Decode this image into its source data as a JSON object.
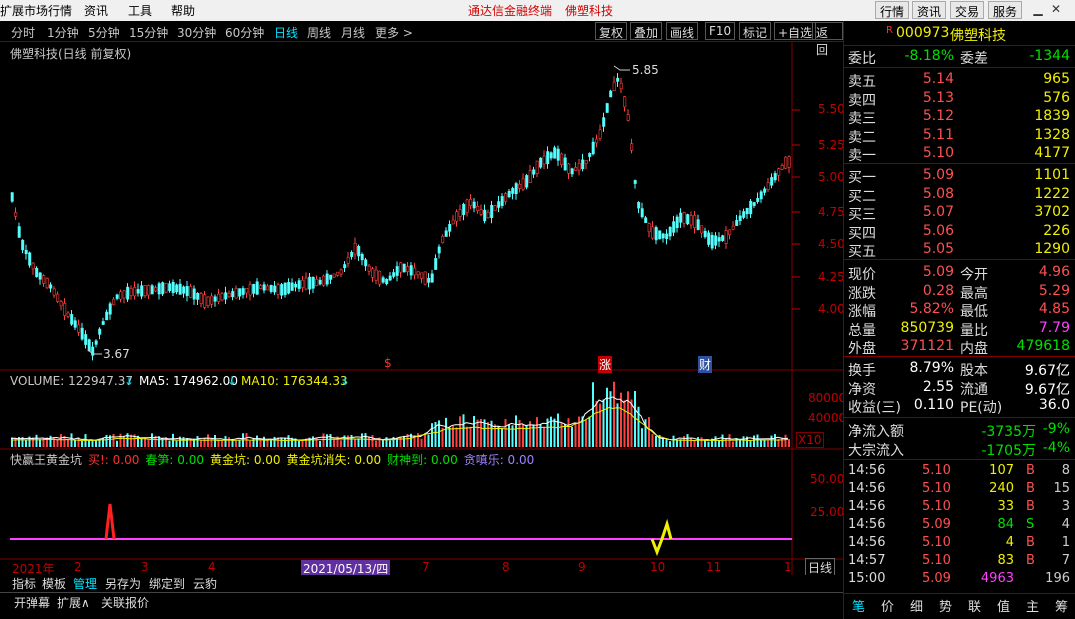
{
  "menubar": {
    "items": [
      "扩展市场行情",
      "资讯",
      "工具",
      "帮助"
    ],
    "center_title": "通达信金融终端",
    "center_stock": "佛塑科技",
    "right_buttons": [
      "行情",
      "资讯",
      "交易",
      "服务"
    ]
  },
  "toolbar": {
    "timeframes": [
      "分时",
      "1分钟",
      "5分钟",
      "15分钟",
      "30分钟",
      "60分钟",
      "日线",
      "周线",
      "月线",
      "更多 >"
    ],
    "active_timeframe": "日线",
    "buttons": [
      "复权",
      "叠加",
      "画线",
      "F10",
      "标记",
      "+自选",
      "返回"
    ]
  },
  "main_chart": {
    "title": "佛塑科技(日线 前复权)",
    "high_label": "5.85",
    "low_label": "3.67",
    "price_axis": [
      "5.50",
      "5.25",
      "5.00",
      "4.75",
      "4.50",
      "4.25",
      "4.00"
    ],
    "markers": [
      "$",
      "涨",
      "财"
    ]
  },
  "volume_panel": {
    "volume_label": "VOLUME: 122947.37",
    "ma5_label": "MA5: 174962.00",
    "ma10_label": "MA10: 176344.33",
    "axis": [
      "80000",
      "40000"
    ],
    "unit": "X10"
  },
  "indicator_panel": {
    "name": "快赢王黄金坑",
    "items": [
      {
        "label": "买!:",
        "value": "0.00",
        "color": "#ff3030"
      },
      {
        "label": "春笋:",
        "value": "0.00",
        "color": "#00e000"
      },
      {
        "label": "黄金坑:",
        "value": "0.00",
        "color": "#f0f000"
      },
      {
        "label": "黄金坑消失:",
        "value": "0.00",
        "color": "#f0f000"
      },
      {
        "label": "财神到:",
        "value": "0.00",
        "color": "#00e000"
      },
      {
        "label": "贪嗔乐:",
        "value": "0.00",
        "color": "#a080ff"
      }
    ],
    "axis": [
      "50.00",
      "25.00"
    ]
  },
  "date_axis": {
    "year_label": "2021年",
    "months": [
      "2",
      "3",
      "4",
      "7",
      "8",
      "9",
      "10",
      "11",
      "1"
    ],
    "cursor_date": "2021/05/13/四",
    "period_label": "日线"
  },
  "bottom_tabs": [
    "指标",
    "模板",
    "管理",
    "另存为",
    "绑定到",
    "云豹"
  ],
  "bottom_tabs_active": "管理",
  "bottom_tabs2": [
    "开弹幕",
    "扩展∧",
    "关联报价"
  ],
  "quote": {
    "flag": "R",
    "code": "000973",
    "name": "佛塑科技",
    "webi_label": "委比",
    "webi_value": "-8.18%",
    "weicha_label": "委差",
    "weicha_value": "-1344",
    "asks": [
      {
        "label": "卖五",
        "price": "5.14",
        "vol": "965"
      },
      {
        "label": "卖四",
        "price": "5.13",
        "vol": "576"
      },
      {
        "label": "卖三",
        "price": "5.12",
        "vol": "1839"
      },
      {
        "label": "卖二",
        "price": "5.11",
        "vol": "1328"
      },
      {
        "label": "卖一",
        "price": "5.10",
        "vol": "4177"
      }
    ],
    "bids": [
      {
        "label": "买一",
        "price": "5.09",
        "vol": "1101"
      },
      {
        "label": "买二",
        "price": "5.08",
        "vol": "1222"
      },
      {
        "label": "买三",
        "price": "5.07",
        "vol": "3702"
      },
      {
        "label": "买四",
        "price": "5.06",
        "vol": "226"
      },
      {
        "label": "买五",
        "price": "5.05",
        "vol": "1290"
      }
    ],
    "stats": [
      {
        "l1": "现价",
        "v1": "5.09",
        "c1": "red",
        "l2": "今开",
        "v2": "4.96",
        "c2": "red"
      },
      {
        "l1": "涨跌",
        "v1": "0.28",
        "c1": "red",
        "l2": "最高",
        "v2": "5.29",
        "c2": "red"
      },
      {
        "l1": "涨幅",
        "v1": "5.82%",
        "c1": "red",
        "l2": "最低",
        "v2": "4.85",
        "c2": "red"
      },
      {
        "l1": "总量",
        "v1": "850739",
        "c1": "yellow",
        "l2": "量比",
        "v2": "7.79",
        "c2": "magenta"
      },
      {
        "l1": "外盘",
        "v1": "371121",
        "c1": "red",
        "l2": "内盘",
        "v2": "479618",
        "c2": "green"
      }
    ],
    "stats2": [
      {
        "l1": "换手",
        "v1": "8.79%",
        "l2": "股本",
        "v2": "9.67亿"
      },
      {
        "l1": "净资",
        "v1": "2.55",
        "l2": "流通",
        "v2": "9.67亿"
      },
      {
        "l1": "收益(三)",
        "v1": "0.110",
        "l2": "PE(动)",
        "v2": "36.0"
      }
    ],
    "flows": [
      {
        "label": "净流入额",
        "value": "-3735万",
        "pct": "-9%"
      },
      {
        "label": "大宗流入",
        "value": "-1705万",
        "pct": "-4%"
      }
    ],
    "ticks": [
      {
        "time": "14:56",
        "price": "5.10",
        "vol": "107",
        "side": "B",
        "n": "8"
      },
      {
        "time": "14:56",
        "price": "5.10",
        "vol": "240",
        "side": "B",
        "n": "15"
      },
      {
        "time": "14:56",
        "price": "5.10",
        "vol": "33",
        "side": "B",
        "n": "3"
      },
      {
        "time": "14:56",
        "price": "5.09",
        "vol": "84",
        "side": "S",
        "n": "4"
      },
      {
        "time": "14:56",
        "price": "5.10",
        "vol": "4",
        "side": "B",
        "n": "1"
      },
      {
        "time": "14:57",
        "price": "5.10",
        "vol": "83",
        "side": "B",
        "n": "7"
      },
      {
        "time": "15:00",
        "price": "5.09",
        "vol": "4963",
        "side": "",
        "n": "196"
      }
    ],
    "side_tabs": [
      "笔",
      "价",
      "细",
      "势",
      "联",
      "值",
      "主",
      "筹"
    ],
    "side_tabs_active": "笔"
  },
  "colors": {
    "up": "#ff4040",
    "down": "#54ffff",
    "ma5": "#ffffff",
    "ma10": "#f0f000",
    "frame": "#800000"
  }
}
